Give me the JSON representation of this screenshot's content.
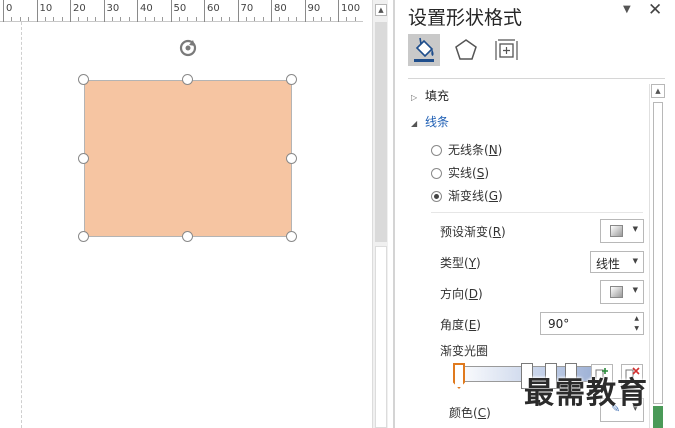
{
  "ruler": {
    "labels": [
      "0",
      "10",
      "20",
      "30",
      "40",
      "50",
      "60",
      "70",
      "80",
      "90",
      "100"
    ]
  },
  "panel": {
    "title": "设置形状格式",
    "tabs": [
      {
        "name": "fill-and-line",
        "icon": "paint-bucket-icon",
        "selected": true
      },
      {
        "name": "effects",
        "icon": "pentagon-icon",
        "selected": false
      },
      {
        "name": "size-and-properties",
        "icon": "size-properties-icon",
        "selected": false
      }
    ],
    "sections": {
      "fill": {
        "label": "填充",
        "expanded": false
      },
      "line": {
        "label": "线条",
        "expanded": true
      }
    },
    "line_options": [
      {
        "label": "无线条(N)",
        "checked": false
      },
      {
        "label": "实线(S)",
        "checked": false
      },
      {
        "label": "渐变线(G)",
        "checked": true
      }
    ],
    "preset_gradient": {
      "label": "预设渐变(R)"
    },
    "type": {
      "label": "类型(Y)",
      "value": "线性"
    },
    "direction": {
      "label": "方向(D)"
    },
    "angle": {
      "label": "角度(E)",
      "value": "90°"
    },
    "gradient_stops": {
      "label": "渐变光圈"
    },
    "color": {
      "label": "颜色(C)"
    }
  },
  "watermark": "最需教育",
  "colors": {
    "shape_fill": "#f6c5a2",
    "accent": "#1f5fb4",
    "selected_tab_bg": "#c9c9c9"
  }
}
